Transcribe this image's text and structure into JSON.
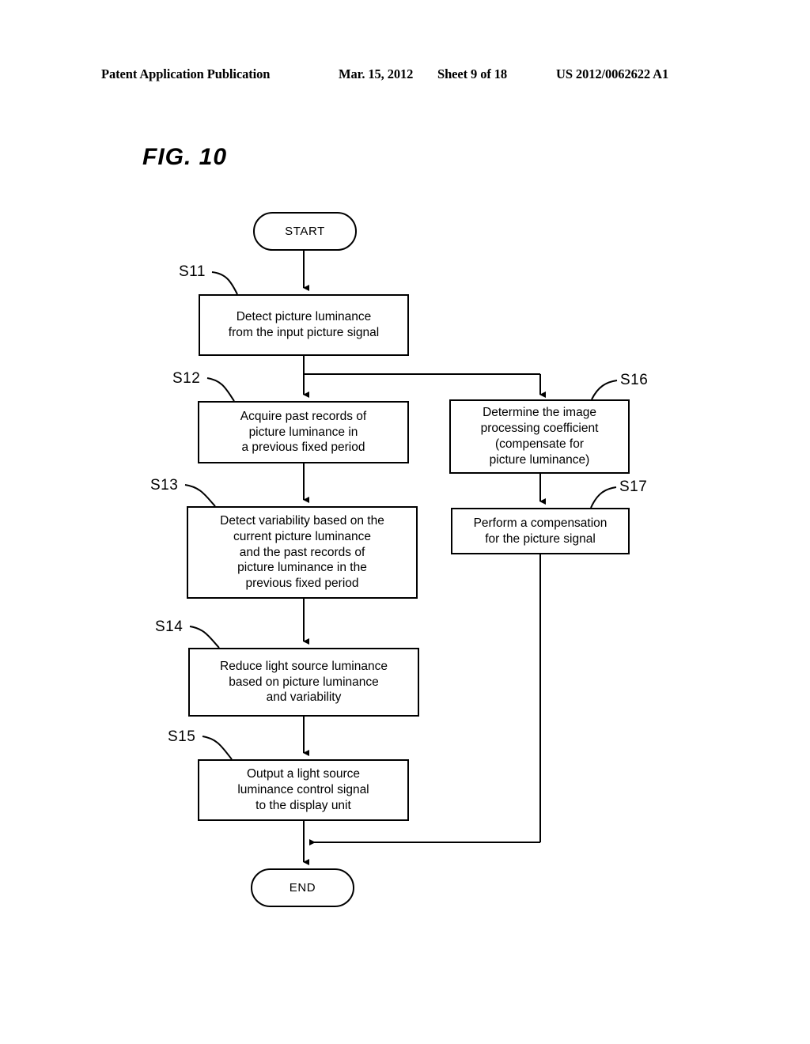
{
  "header": {
    "publication": "Patent Application Publication",
    "date": "Mar. 15, 2012",
    "sheet": "Sheet 9 of 18",
    "document_id": "US 2012/0062622 A1"
  },
  "figure": {
    "label": "FIG. 10"
  },
  "flowchart": {
    "start_label": "START",
    "end_label": "END",
    "steps": [
      {
        "id": "S11",
        "ref": "S11",
        "lines": [
          "Detect picture luminance",
          "from the input picture signal"
        ]
      },
      {
        "id": "S12",
        "ref": "S12",
        "lines": [
          "Acquire past records of",
          "picture luminance in",
          "a previous fixed period"
        ]
      },
      {
        "id": "S13",
        "ref": "S13",
        "lines": [
          "Detect variability based on the",
          "current picture luminance",
          "and the past records of",
          "picture luminance in the",
          "previous fixed period"
        ]
      },
      {
        "id": "S14",
        "ref": "S14",
        "lines": [
          "Reduce light source luminance",
          "based on picture luminance",
          "and variability"
        ]
      },
      {
        "id": "S15",
        "ref": "S15",
        "lines": [
          "Output a light source",
          "luminance control signal",
          "to the display unit"
        ]
      },
      {
        "id": "S16",
        "ref": "S16",
        "lines": [
          "Determine the image",
          "processing coefficient",
          "(compensate for",
          "picture luminance)"
        ]
      },
      {
        "id": "S17",
        "ref": "S17",
        "lines": [
          "Perform a compensation",
          "for the picture signal"
        ]
      }
    ]
  },
  "colors": {
    "ink": "#000000",
    "paper": "#ffffff"
  }
}
